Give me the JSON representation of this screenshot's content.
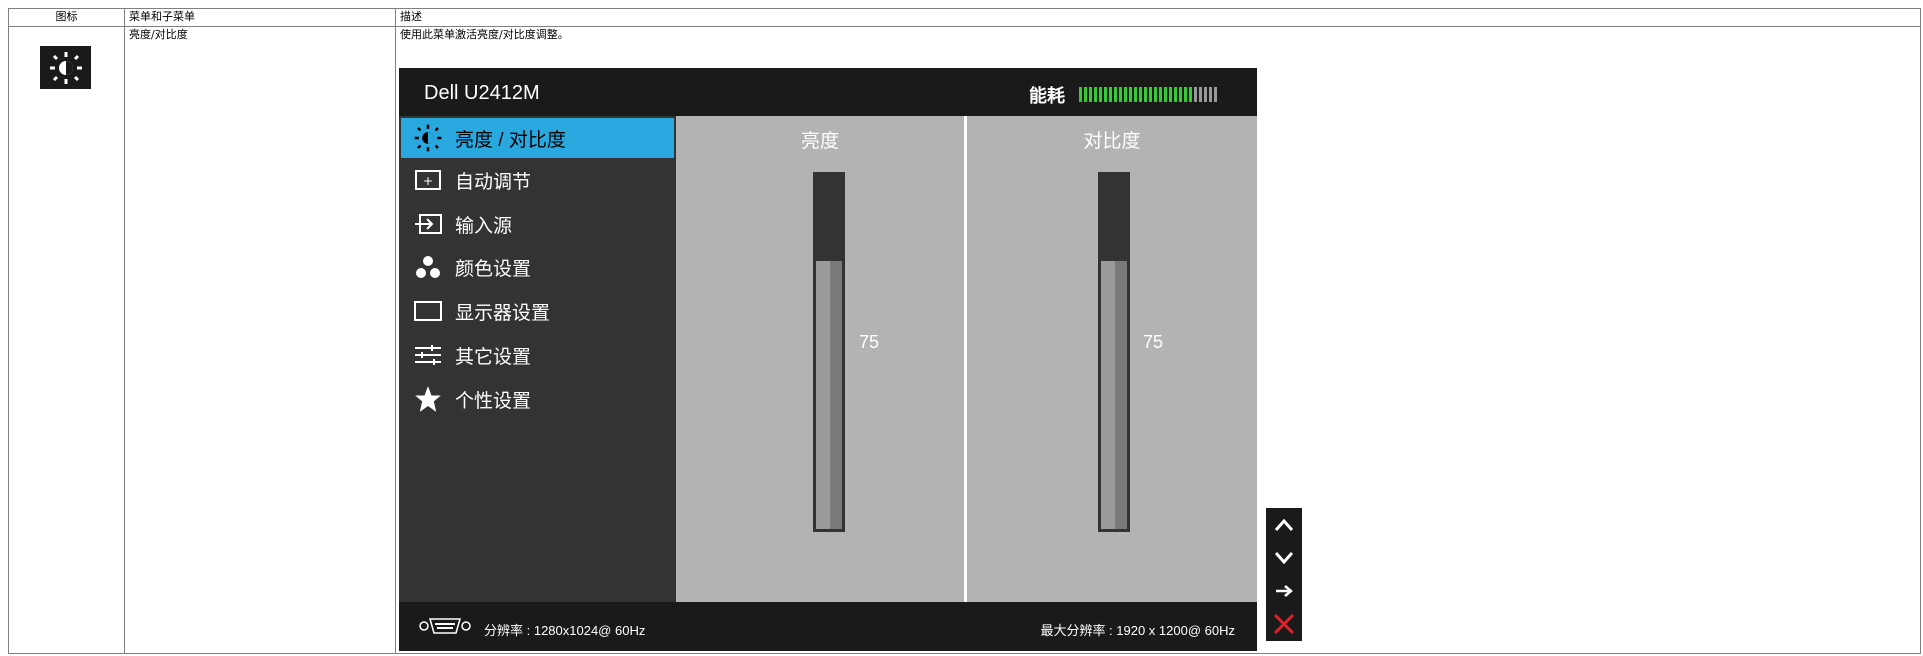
{
  "table": {
    "headers": [
      "图标",
      "菜单和子菜单",
      "描述"
    ],
    "row": {
      "icon": "brightness-icon",
      "menu_label": "亮度/对比度",
      "description": "使用此菜单激活亮度/对比度调整。"
    }
  },
  "osd": {
    "title": "Dell U2412M",
    "energy_label": "能耗",
    "energy_level": 0.82,
    "menu_items": [
      {
        "label": "亮度 / 对比度",
        "icon": "brightness-icon",
        "selected": true
      },
      {
        "label": "自动调节",
        "icon": "auto-adjust-icon",
        "selected": false
      },
      {
        "label": "输入源",
        "icon": "input-source-icon",
        "selected": false
      },
      {
        "label": "颜色设置",
        "icon": "color-settings-icon",
        "selected": false
      },
      {
        "label": "显示器设置",
        "icon": "display-settings-icon",
        "selected": false
      },
      {
        "label": "其它设置",
        "icon": "other-settings-icon",
        "selected": false
      },
      {
        "label": "个性设置",
        "icon": "star-icon",
        "selected": false
      }
    ],
    "brightness": {
      "label": "亮度",
      "value": "75"
    },
    "contrast": {
      "label": "对比度",
      "value": "75"
    },
    "footer": {
      "resolution": "分辨率 : 1280x1024@ 60Hz",
      "max_resolution": "最大分辨率 : 1920 x 1200@ 60Hz"
    },
    "colors": {
      "selected": "#29a8e0",
      "energy_on": "#33cc33",
      "energy_off": "#999999",
      "close": "#e0202a"
    }
  },
  "controls": [
    "up-arrow-icon",
    "down-arrow-icon",
    "right-arrow-icon",
    "close-icon"
  ]
}
